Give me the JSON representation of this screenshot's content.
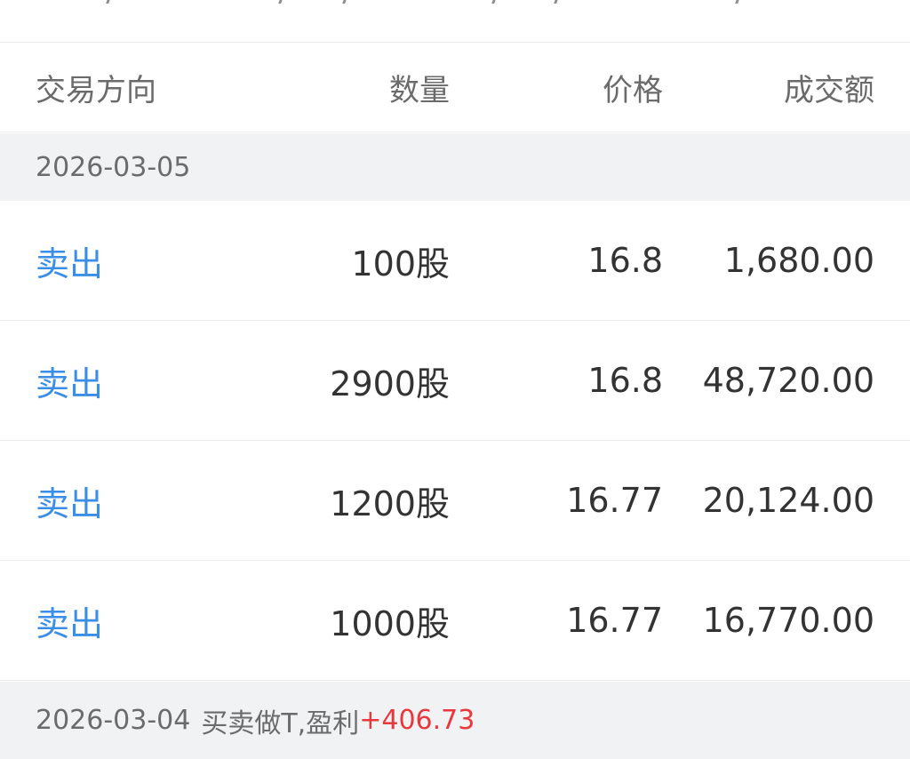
{
  "columns": {
    "direction": "交易方向",
    "quantity": "数量",
    "price": "价格",
    "amount": "成交额"
  },
  "groups": [
    {
      "date": "2026-03-05",
      "trades": [
        {
          "direction": "卖出",
          "quantity": "100股",
          "price": "16.8",
          "amount": "1,680.00"
        },
        {
          "direction": "卖出",
          "quantity": "2900股",
          "price": "16.8",
          "amount": "48,720.00"
        },
        {
          "direction": "卖出",
          "quantity": "1200股",
          "price": "16.77",
          "amount": "20,124.00"
        },
        {
          "direction": "卖出",
          "quantity": "1000股",
          "price": "16.77",
          "amount": "16,770.00"
        }
      ]
    },
    {
      "date": "2026-03-04",
      "note": "买卖做T,盈利",
      "profit": "+406.73"
    }
  ],
  "colors": {
    "sell": "#3b8ee8",
    "profit": "#e8383d",
    "group_bg": "#f1f2f4"
  }
}
